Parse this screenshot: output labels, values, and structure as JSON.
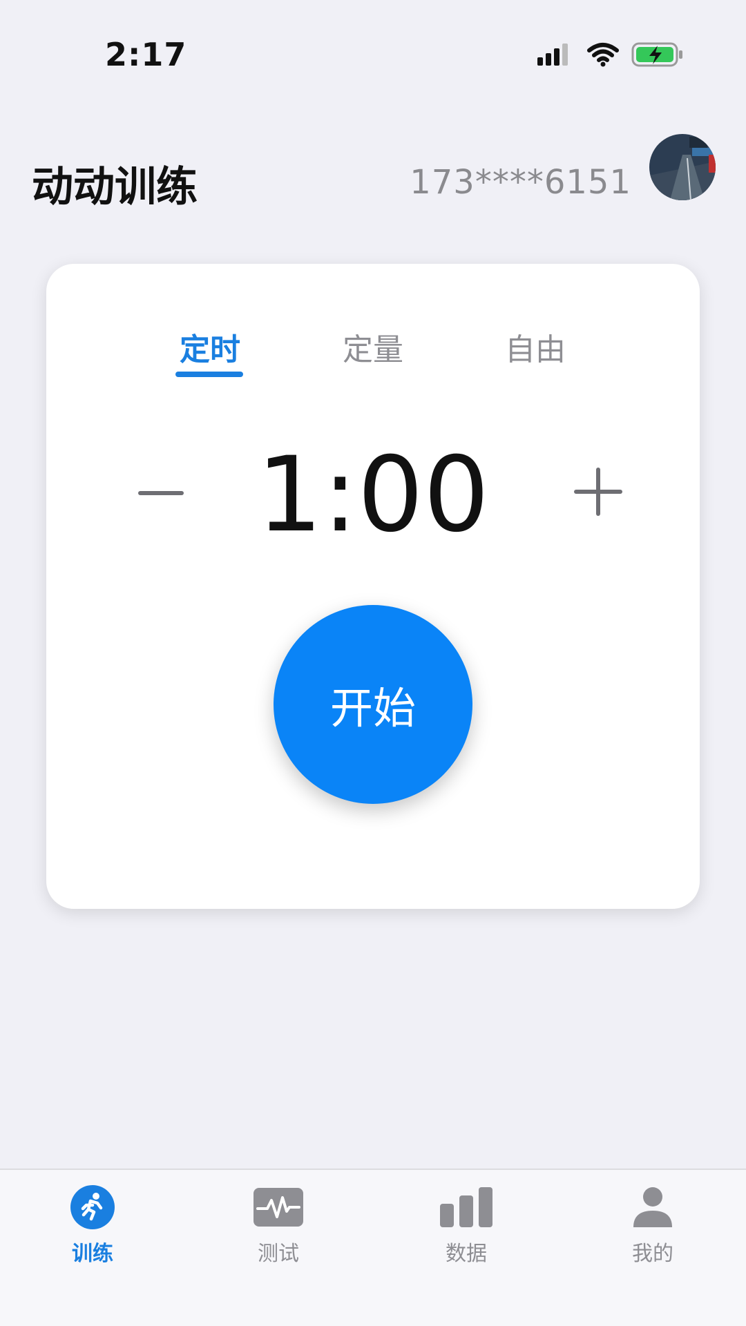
{
  "status_bar": {
    "time": "2:17"
  },
  "header": {
    "title": "动动训练",
    "phone": "173****6151"
  },
  "mode_tabs": [
    {
      "label": "定时",
      "active": true
    },
    {
      "label": "定量",
      "active": false
    },
    {
      "label": "自由",
      "active": false
    }
  ],
  "timer": {
    "value": "1:00"
  },
  "start_button": {
    "label": "开始"
  },
  "tabbar": [
    {
      "label": "训练",
      "icon": "run-icon",
      "active": true
    },
    {
      "label": "测试",
      "icon": "pulse-icon",
      "active": false
    },
    {
      "label": "数据",
      "icon": "bar-chart-icon",
      "active": false
    },
    {
      "label": "我的",
      "icon": "person-icon",
      "active": false
    }
  ],
  "colors": {
    "accent": "#1a7fe0",
    "start_button": "#0a84f7",
    "background": "#f0f0f6",
    "battery": "#34c759"
  }
}
